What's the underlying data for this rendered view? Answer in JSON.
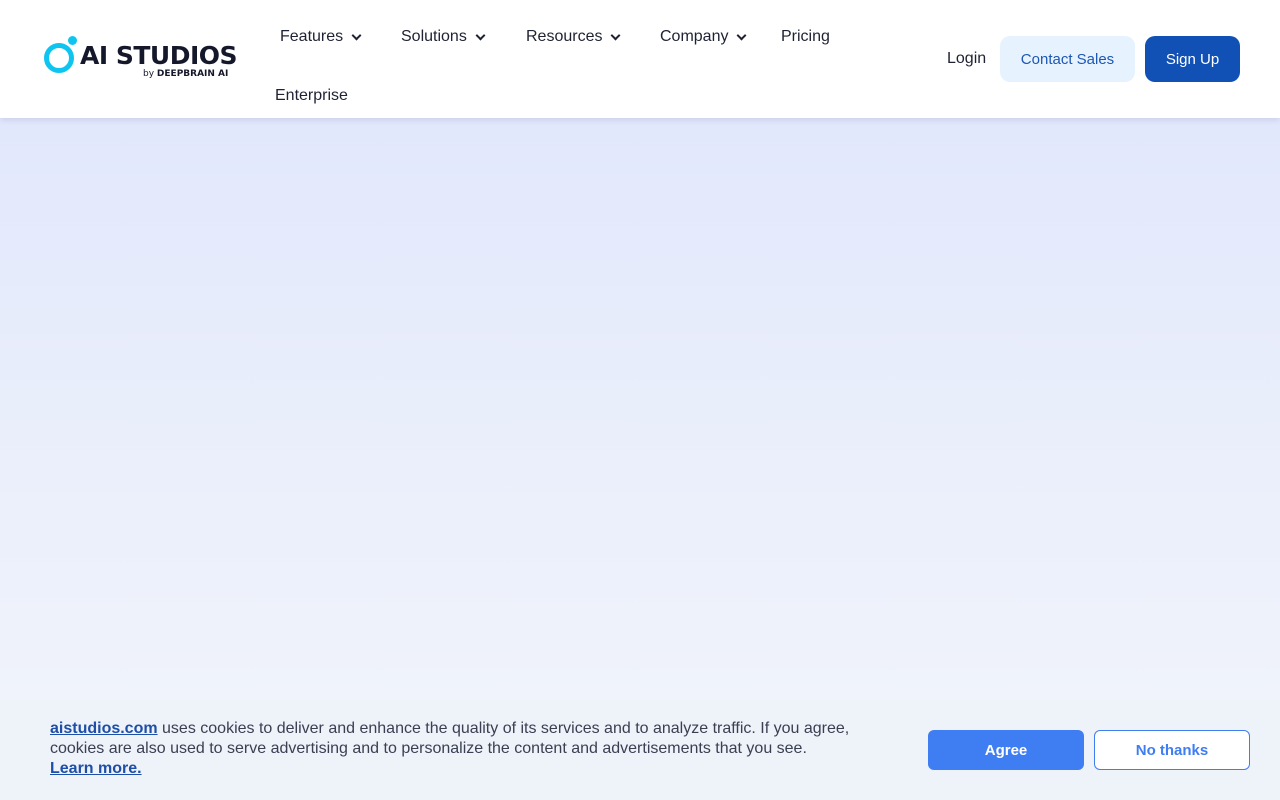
{
  "logo": {
    "title": "AI STUDIOS",
    "sub_by": "by",
    "sub_brand": "DEEPBRAIN AI",
    "mark_icon": "ring-dot-logo-icon",
    "brand_color": "#0ec5f0"
  },
  "nav": {
    "items": [
      {
        "label": "Features",
        "has_dropdown": true
      },
      {
        "label": "Solutions",
        "has_dropdown": true
      },
      {
        "label": "Resources",
        "has_dropdown": true
      },
      {
        "label": "Company",
        "has_dropdown": true
      },
      {
        "label": "Pricing",
        "has_dropdown": false
      },
      {
        "label": "Enterprise",
        "has_dropdown": false
      }
    ],
    "dropdown_icon": "chevron-down-icon"
  },
  "header_actions": {
    "login_label": "Login",
    "contact_label": "Contact Sales",
    "signup_label": "Sign Up",
    "signup_color": "#1150b5",
    "contact_bg_color": "#e6f3fe"
  },
  "cookie_banner": {
    "site_link": "aistudios.com",
    "message": " uses cookies to deliver and enhance the quality of its services and to analyze traffic. If you agree, cookies are also used to serve advertising and to personalize the content and advertisements that you see.",
    "learn_more": "Learn more.",
    "agree_label": "Agree",
    "decline_label": "No thanks",
    "accent_color": "#3f7df3"
  }
}
